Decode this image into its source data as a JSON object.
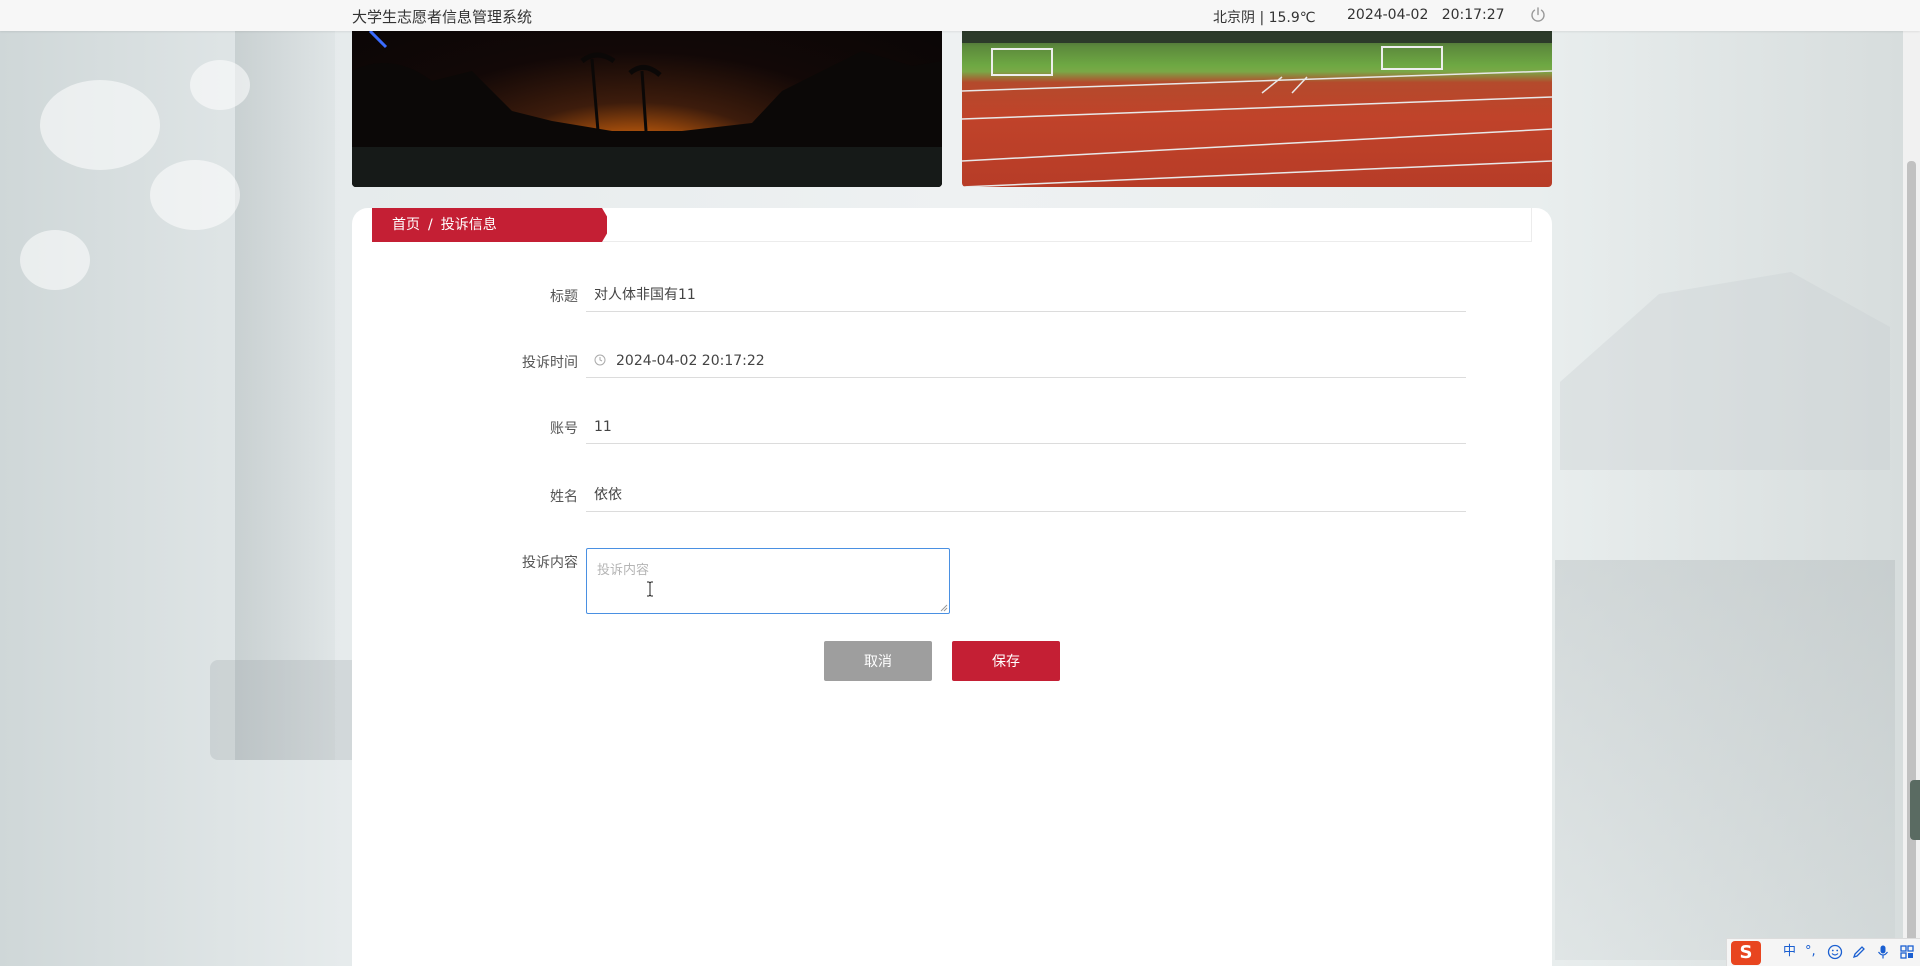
{
  "app": {
    "title": "大学生志愿者信息管理系统"
  },
  "header": {
    "weather": "北京阴 | 15.9℃",
    "datetime": "2024-04-02   20:17:27"
  },
  "breadcrumb": {
    "home": "首页",
    "separator": "/",
    "current": "投诉信息"
  },
  "form": {
    "title": {
      "label": "标题",
      "value": "对人体非国有11"
    },
    "time": {
      "label": "投诉时间",
      "value": "2024-04-02 20:17:22"
    },
    "account": {
      "label": "账号",
      "value": "11"
    },
    "name": {
      "label": "姓名",
      "value": "依依"
    },
    "content": {
      "label": "投诉内容",
      "placeholder": "投诉内容",
      "value": ""
    }
  },
  "buttons": {
    "cancel": "取消",
    "save": "保存"
  },
  "ime": {
    "logo": "S",
    "mode": "中",
    "punct": "°,"
  },
  "colors": {
    "accent": "#c41f34",
    "cancel": "#9e9e9e",
    "focus_border": "#4a90e2"
  }
}
